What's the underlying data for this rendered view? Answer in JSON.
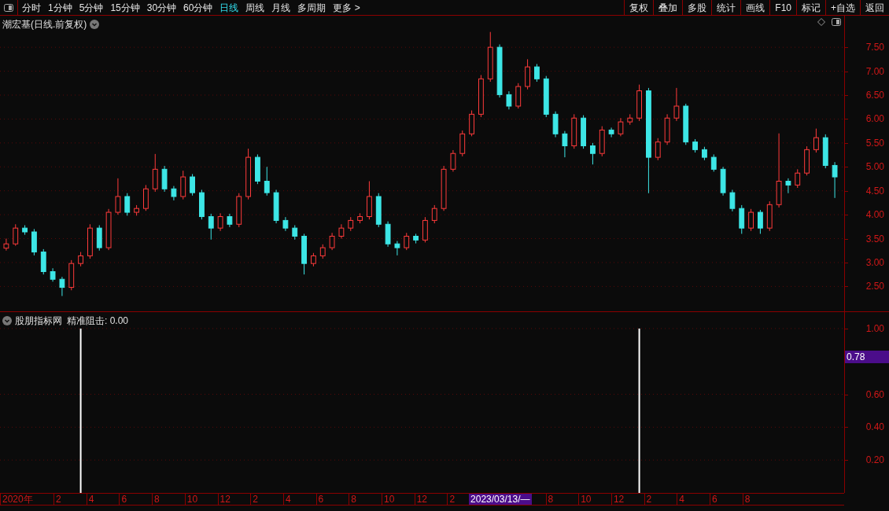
{
  "toolbar": {
    "tabs": [
      {
        "label": "分时",
        "selected": false
      },
      {
        "label": "1分钟",
        "selected": false
      },
      {
        "label": "5分钟",
        "selected": false
      },
      {
        "label": "15分钟",
        "selected": false
      },
      {
        "label": "30分钟",
        "selected": false
      },
      {
        "label": "60分钟",
        "selected": false
      },
      {
        "label": "日线",
        "selected": true
      },
      {
        "label": "周线",
        "selected": false
      },
      {
        "label": "月线",
        "selected": false
      },
      {
        "label": "多周期",
        "selected": false
      },
      {
        "label": "更多 >",
        "selected": false
      }
    ],
    "buttons": [
      "复权",
      "叠加",
      "多股",
      "统计",
      "画线",
      "F10",
      "标记",
      "+自选",
      "返回"
    ]
  },
  "price_panel": {
    "title": "潮宏基(日线.前复权)",
    "chart_data": {
      "type": "candlestick",
      "grid": true,
      "ylim": [
        1.98,
        8.16
      ],
      "yticks": [
        {
          "value": 7.5,
          "label": "7.50"
        },
        {
          "value": 7,
          "label": "7.00"
        },
        {
          "value": 6.5,
          "label": "6.50"
        },
        {
          "value": 6,
          "label": "6.00"
        },
        {
          "value": 5.5,
          "label": "5.50"
        },
        {
          "value": 5,
          "label": "5.00"
        },
        {
          "value": 4.5,
          "label": "4.50"
        },
        {
          "value": 4,
          "label": "4.00"
        },
        {
          "value": 3.5,
          "label": "3.50"
        },
        {
          "value": 3,
          "label": "3.00"
        },
        {
          "value": 2.5,
          "label": "2.50"
        }
      ],
      "ohlc": [
        [
          3.3,
          3.5,
          3.25,
          3.39
        ],
        [
          3.39,
          3.8,
          3.35,
          3.72
        ],
        [
          3.72,
          3.78,
          3.58,
          3.64
        ],
        [
          3.64,
          3.7,
          3.15,
          3.22
        ],
        [
          3.22,
          3.28,
          2.75,
          2.81
        ],
        [
          2.81,
          2.88,
          2.6,
          2.65
        ],
        [
          2.65,
          2.7,
          2.3,
          2.48
        ],
        [
          2.48,
          3.05,
          2.42,
          2.98
        ],
        [
          2.98,
          3.22,
          2.92,
          3.14
        ],
        [
          3.14,
          3.8,
          3.08,
          3.72
        ],
        [
          3.72,
          3.78,
          3.25,
          3.31
        ],
        [
          3.31,
          4.12,
          3.26,
          4.05
        ],
        [
          4.05,
          4.76,
          4.0,
          4.38
        ],
        [
          4.38,
          4.45,
          3.98,
          4.05
        ],
        [
          4.05,
          4.2,
          3.98,
          4.13
        ],
        [
          4.13,
          4.62,
          4.08,
          4.54
        ],
        [
          4.54,
          5.27,
          4.48,
          4.95
        ],
        [
          4.95,
          5.02,
          4.48,
          4.54
        ],
        [
          4.54,
          4.6,
          4.3,
          4.38
        ],
        [
          4.38,
          4.92,
          4.32,
          4.79
        ],
        [
          4.79,
          4.85,
          4.4,
          4.46
        ],
        [
          4.46,
          4.52,
          3.9,
          3.96
        ],
        [
          3.96,
          4.02,
          3.48,
          3.72
        ],
        [
          3.72,
          4.03,
          3.66,
          3.96
        ],
        [
          3.96,
          4.02,
          3.74,
          3.8
        ],
        [
          3.8,
          4.45,
          3.74,
          4.38
        ],
        [
          4.38,
          5.38,
          4.32,
          5.2
        ],
        [
          5.2,
          5.26,
          4.64,
          4.7
        ],
        [
          4.7,
          5.0,
          4.4,
          4.46
        ],
        [
          4.46,
          4.52,
          3.82,
          3.88
        ],
        [
          3.88,
          3.95,
          3.66,
          3.72
        ],
        [
          3.72,
          3.78,
          3.48,
          3.55
        ],
        [
          3.55,
          3.6,
          2.75,
          2.98
        ],
        [
          2.98,
          3.2,
          2.92,
          3.14
        ],
        [
          3.14,
          3.38,
          3.08,
          3.31
        ],
        [
          3.31,
          3.62,
          3.26,
          3.55
        ],
        [
          3.55,
          3.8,
          3.5,
          3.72
        ],
        [
          3.72,
          3.95,
          3.66,
          3.88
        ],
        [
          3.88,
          4.03,
          3.82,
          3.96
        ],
        [
          3.96,
          4.7,
          3.9,
          4.38
        ],
        [
          4.38,
          4.45,
          3.74,
          3.8
        ],
        [
          3.8,
          3.86,
          3.33,
          3.39
        ],
        [
          3.39,
          3.45,
          3.15,
          3.31
        ],
        [
          3.31,
          3.62,
          3.26,
          3.55
        ],
        [
          3.55,
          3.6,
          3.4,
          3.47
        ],
        [
          3.47,
          3.95,
          3.42,
          3.88
        ],
        [
          3.88,
          4.2,
          3.82,
          4.13
        ],
        [
          4.13,
          5.02,
          4.08,
          4.95
        ],
        [
          4.95,
          5.35,
          4.9,
          5.28
        ],
        [
          5.28,
          5.76,
          5.22,
          5.69
        ],
        [
          5.69,
          6.18,
          5.64,
          6.1
        ],
        [
          6.1,
          6.92,
          6.04,
          6.84
        ],
        [
          6.84,
          7.82,
          6.78,
          7.5
        ],
        [
          7.5,
          7.56,
          6.45,
          6.51
        ],
        [
          6.51,
          6.58,
          6.2,
          6.27
        ],
        [
          6.27,
          6.75,
          6.22,
          6.68
        ],
        [
          6.68,
          7.25,
          6.62,
          7.09
        ],
        [
          7.09,
          7.15,
          6.78,
          6.84
        ],
        [
          6.84,
          6.9,
          6.04,
          6.1
        ],
        [
          6.1,
          6.16,
          5.62,
          5.69
        ],
        [
          5.69,
          5.75,
          5.2,
          5.44
        ],
        [
          5.44,
          6.1,
          5.38,
          6.02
        ],
        [
          6.02,
          6.08,
          5.38,
          5.44
        ],
        [
          5.44,
          5.5,
          5.05,
          5.28
        ],
        [
          5.28,
          5.85,
          5.22,
          5.77
        ],
        [
          5.77,
          5.82,
          5.62,
          5.69
        ],
        [
          5.69,
          6.02,
          5.64,
          5.94
        ],
        [
          5.94,
          6.1,
          5.88,
          6.02
        ],
        [
          6.02,
          6.72,
          5.96,
          6.59
        ],
        [
          6.59,
          6.65,
          4.45,
          5.2
        ],
        [
          5.2,
          5.6,
          5.14,
          5.52
        ],
        [
          5.52,
          6.1,
          5.46,
          6.02
        ],
        [
          6.02,
          6.65,
          5.96,
          6.27
        ],
        [
          6.27,
          6.32,
          5.46,
          5.52
        ],
        [
          5.52,
          5.58,
          5.3,
          5.36
        ],
        [
          5.36,
          5.42,
          5.14,
          5.2
        ],
        [
          5.2,
          5.26,
          4.9,
          4.95
        ],
        [
          4.95,
          5.0,
          4.4,
          4.46
        ],
        [
          4.46,
          4.52,
          4.07,
          4.13
        ],
        [
          4.13,
          4.2,
          3.6,
          3.72
        ],
        [
          3.72,
          4.12,
          3.66,
          4.05
        ],
        [
          4.05,
          4.1,
          3.6,
          3.72
        ],
        [
          3.72,
          4.28,
          3.66,
          4.21
        ],
        [
          4.21,
          5.7,
          4.15,
          4.7
        ],
        [
          4.7,
          4.76,
          4.45,
          4.62
        ],
        [
          4.62,
          4.95,
          4.56,
          4.87
        ],
        [
          4.87,
          5.43,
          4.82,
          5.36
        ],
        [
          5.36,
          5.8,
          5.3,
          5.61
        ],
        [
          5.61,
          5.68,
          4.97,
          5.03
        ],
        [
          5.03,
          5.1,
          4.35,
          4.79
        ]
      ]
    }
  },
  "indicator_panel": {
    "name": "股朋指标网",
    "reading": "精准阻击: 0.00",
    "current_value": "0.78",
    "chart_data": {
      "type": "bar",
      "grid": true,
      "ylim": [
        0,
        1.1
      ],
      "yticks": [
        {
          "value": 1,
          "label": "1.00"
        },
        {
          "value": 0.6,
          "label": "0.60"
        },
        {
          "value": 0.4,
          "label": "0.40"
        },
        {
          "value": 0.2,
          "label": "0.20"
        }
      ],
      "values": [
        null,
        null,
        null,
        null,
        null,
        null,
        null,
        null,
        1,
        null,
        null,
        null,
        null,
        null,
        null,
        null,
        null,
        null,
        null,
        null,
        null,
        null,
        null,
        null,
        null,
        null,
        null,
        null,
        null,
        null,
        null,
        null,
        null,
        null,
        null,
        null,
        null,
        null,
        null,
        null,
        null,
        null,
        null,
        null,
        null,
        null,
        null,
        null,
        null,
        null,
        null,
        null,
        null,
        null,
        null,
        null,
        null,
        null,
        null,
        null,
        null,
        null,
        null,
        null,
        null,
        null,
        null,
        null,
        1,
        null,
        null,
        null,
        null,
        null,
        null,
        null,
        null,
        null,
        null,
        null,
        null,
        null,
        null,
        null,
        null,
        null,
        null,
        null,
        null,
        null
      ]
    }
  },
  "time_axis": [
    {
      "label": "2020年",
      "selected": false
    },
    {
      "label": "2",
      "selected": false
    },
    {
      "label": "4",
      "selected": false
    },
    {
      "label": "6",
      "selected": false
    },
    {
      "label": "8",
      "selected": false
    },
    {
      "label": "10",
      "selected": false
    },
    {
      "label": "12",
      "selected": false
    },
    {
      "label": "2",
      "selected": false
    },
    {
      "label": "4",
      "selected": false
    },
    {
      "label": "6",
      "selected": false
    },
    {
      "label": "8",
      "selected": false
    },
    {
      "label": "10",
      "selected": false
    },
    {
      "label": "12",
      "selected": false
    },
    {
      "label": "2",
      "selected": false
    },
    {
      "label": "2023/03/13/—",
      "selected": true
    },
    {
      "label": "8",
      "selected": false
    },
    {
      "label": "10",
      "selected": false
    },
    {
      "label": "12",
      "selected": false
    },
    {
      "label": "2",
      "selected": false
    },
    {
      "label": "4",
      "selected": false
    },
    {
      "label": "6",
      "selected": false
    },
    {
      "label": "8",
      "selected": false
    }
  ]
}
